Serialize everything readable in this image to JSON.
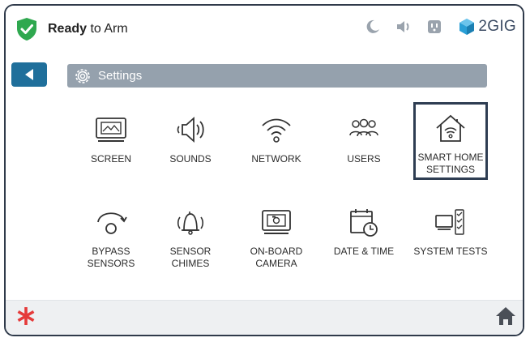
{
  "status": {
    "bold": "Ready",
    "rest": " to Arm",
    "shield_color": "#2fa84f"
  },
  "brand": {
    "text": "2GIG",
    "color": "#3b4b63"
  },
  "top_icons": [
    "moon-icon",
    "speaker-icon",
    "outlet-icon"
  ],
  "header": {
    "title": "Settings"
  },
  "tiles": [
    {
      "label": "SCREEN",
      "icon": "screen-icon"
    },
    {
      "label": "SOUNDS",
      "icon": "sounds-icon"
    },
    {
      "label": "NETWORK",
      "icon": "network-icon"
    },
    {
      "label": "USERS",
      "icon": "users-icon"
    },
    {
      "label_lines": [
        "SMART HOME",
        "SETTINGS"
      ],
      "icon": "smart-home-icon",
      "selected": true
    },
    {
      "label_lines": [
        "BYPASS",
        "SENSORS"
      ],
      "icon": "bypass-icon"
    },
    {
      "label": "SENSOR CHIMES",
      "icon": "chimes-icon"
    },
    {
      "label_lines": [
        "ON-BOARD",
        "CAMERA"
      ],
      "icon": "camera-icon"
    },
    {
      "label": "DATE & TIME",
      "icon": "calendar-clock-icon"
    },
    {
      "label": "SYSTEM TESTS",
      "icon": "system-tests-icon"
    }
  ],
  "colors": {
    "accent": "#1f6f9b",
    "header_bar": "#95a1ad",
    "emergency": "#e53a3a",
    "home": "#4a4f57"
  }
}
